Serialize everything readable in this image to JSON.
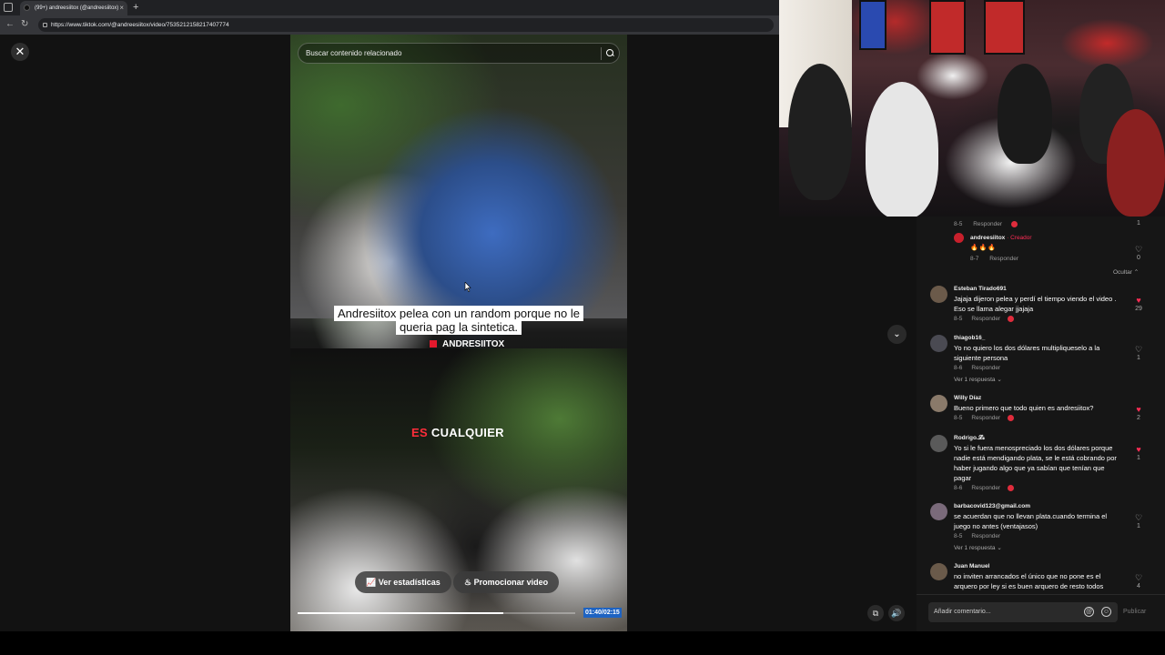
{
  "browser": {
    "tab_title": "(99+) andreesiitox (@andreesiitox)",
    "new_tab": "+",
    "tab_close": "×",
    "url": "https://www.tiktok.com/@andreesiitox/video/7535212158217407774",
    "back": "←",
    "reload": "↻"
  },
  "player": {
    "close": "✕",
    "search_placeholder": "Buscar contenido relacionado",
    "caption_line1": "Andresiitox pelea con un random porque no le",
    "caption_line2": "queria pag    la sintetica.",
    "watermark": "ANDRESIITOX",
    "subtitle_red": "ES",
    "subtitle_white": "CUALQUIER",
    "stats_button": "Ver estadísticas",
    "promote_button": "Promocionar video",
    "time": "01:40/02:15",
    "progress": 0.74,
    "down_arrow": "⌄"
  },
  "comments": {
    "top_reply": {
      "meta_date": "8-5",
      "meta_reply": "Responder",
      "likes": "1"
    },
    "creator_reply": {
      "user": "andreesiitox",
      "creator_label": "· Creador",
      "emojis": "🔥🔥🔥",
      "meta_date": "8-7",
      "meta_reply": "Responder",
      "likes": "0"
    },
    "hide": "Ocultar ⌃",
    "items": [
      {
        "user": "Esteban Tirado691",
        "text": "Jajaja dijeron pelea y perdí el tiempo viendo el video . Eso se llama alegar jjajaja",
        "date": "8-5",
        "reply": "Responder",
        "likes": "29",
        "liked": true,
        "more": ""
      },
      {
        "user": "thiagob16_",
        "text": "Yo no quiero los dos dólares multipliqueselo a la siguiente persona",
        "date": "8-6",
        "reply": "Responder",
        "likes": "1",
        "liked": false,
        "more": "Ver 1 respuesta ⌄"
      },
      {
        "user": "Willy Díaz",
        "text": "Bueno primero que todo quien es andresiitox?",
        "date": "8-5",
        "reply": "Responder",
        "likes": "2",
        "liked": true,
        "more": ""
      },
      {
        "user": "Rodrigo.𝓛𝓼",
        "text": "Yo si le fuera menospreciado los dos dólares porque nadie está mendigando plata, se le está cobrando por haber jugando algo que ya sabían que tenían que pagar",
        "date": "8-6",
        "reply": "Responder",
        "likes": "1",
        "liked": true,
        "more": ""
      },
      {
        "user": "barbacovid123@gmail.com",
        "text": "se acuerdan que no llevan plata.cuando termina el juego no antes (ventajasos)",
        "date": "8-5",
        "reply": "Responder",
        "likes": "1",
        "liked": false,
        "more": "Ver 1 respuesta ⌄"
      },
      {
        "user": "Juan Manuel",
        "text": "no inviten arrancados el único que no pone es el arquero por ley si es buen arquero de resto todos",
        "date": "",
        "reply": "",
        "likes": "4",
        "liked": false,
        "more": ""
      }
    ],
    "input_placeholder": "Añadir comentario...",
    "publish": "Publicar",
    "mention_icon": "@",
    "emoji_icon": "☺"
  },
  "colors": {
    "accent": "#fe2c55",
    "time_badge": "#1e63c2"
  }
}
